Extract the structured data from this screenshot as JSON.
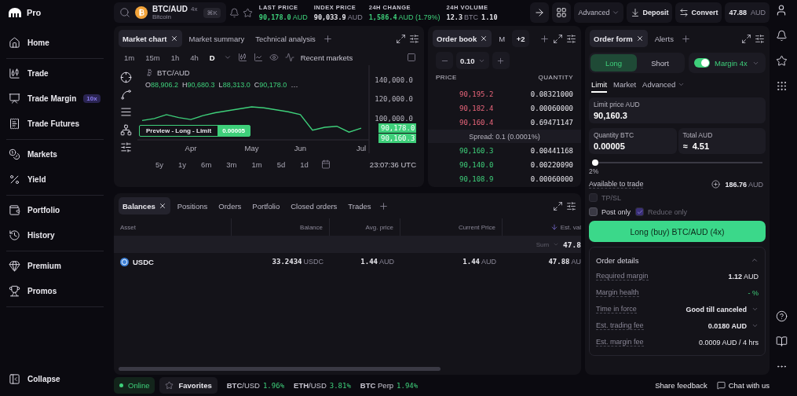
{
  "sidebar": {
    "logo": "Pro",
    "groups": [
      {
        "items": [
          {
            "label": "Home"
          }
        ]
      },
      {
        "items": [
          {
            "label": "Trade"
          },
          {
            "label": "Trade Margin",
            "badge": "10x"
          },
          {
            "label": "Trade Futures"
          }
        ]
      },
      {
        "items": [
          {
            "label": "Markets"
          },
          {
            "label": "Yield"
          }
        ]
      },
      {
        "items": [
          {
            "label": "Portfolio"
          },
          {
            "label": "History"
          }
        ]
      },
      {
        "items": [
          {
            "label": "Premium"
          },
          {
            "label": "Promos"
          }
        ]
      }
    ],
    "collapse": "Collapse"
  },
  "header": {
    "pair": "BTC/AUD",
    "leverage": "4x",
    "name": "Bitcoin",
    "shortcut": "⌘K",
    "stats": [
      {
        "label": "LAST PRICE",
        "value": "90,178.0",
        "unit": "AUD",
        "positive": true
      },
      {
        "label": "INDEX PRICE",
        "value": "90,033.9",
        "unit": "AUD",
        "positive": false
      },
      {
        "label": "24H CHANGE",
        "value": "1,586.4",
        "unit": "AUD (1.79%)",
        "positive": true
      },
      {
        "label": "24H VOLUME",
        "value": "12.3",
        "unit": "BTC",
        "extra": "1.10",
        "positive": false
      }
    ],
    "view_menu": "Advanced",
    "deposit": "Deposit",
    "convert": "Convert",
    "balance": "47.88",
    "balance_unit": "AUD"
  },
  "chart_panel": {
    "tabs": [
      {
        "label": "Market chart",
        "selected": true
      },
      {
        "label": "Market summary",
        "selected": false
      },
      {
        "label": "Technical analysis",
        "selected": false
      }
    ],
    "timeframes": [
      {
        "label": "1m",
        "selected": false
      },
      {
        "label": "15m",
        "selected": false
      },
      {
        "label": "1h",
        "selected": false
      },
      {
        "label": "4h",
        "selected": false
      },
      {
        "label": "D",
        "selected": true
      }
    ],
    "recent": "Recent markets",
    "legend": {
      "ohlc": [
        {
          "key": "O",
          "value": "88,906.2"
        },
        {
          "key": "H",
          "value": "90,680.3"
        },
        {
          "key": "L",
          "value": "88,313.0"
        },
        {
          "key": "C",
          "value": "90,178.0"
        }
      ],
      "more": "…"
    },
    "preview": {
      "label": "Preview - Long - Limit",
      "quantity": "0.00005"
    },
    "price_tags": [
      "90,178.0",
      "90,160.3"
    ],
    "chart_data": {
      "type": "line",
      "categories": [
        null,
        null,
        null,
        null,
        "Apr",
        null,
        null,
        null,
        null,
        "May",
        null,
        null,
        null,
        "Jun",
        null,
        null,
        null,
        null,
        "Jul"
      ],
      "series": [
        {
          "name": "BTC/AUD",
          "color": "#3ecf7a",
          "values": [
            98000,
            100000,
            104000,
            101000,
            99000,
            103000,
            106000,
            108000,
            110000,
            112000,
            111000,
            109000,
            107000,
            104000,
            88000,
            91000,
            92000,
            86000,
            90000
          ]
        }
      ],
      "ylim": [
        78000,
        155000
      ],
      "yticks": [
        {
          "value": 100000,
          "label": "100,000.0"
        },
        {
          "value": 120000,
          "label": "120,000.0"
        },
        {
          "value": 140000,
          "label": "140,000.0"
        }
      ]
    },
    "ranges": [
      "5y",
      "1y",
      "6m",
      "3m",
      "1m",
      "5d",
      "1d"
    ],
    "clock": "23:07:36 UTC"
  },
  "order_book": {
    "tabs": [
      {
        "label": "Order book",
        "selected": true
      },
      {
        "label": "M",
        "selected": false
      }
    ],
    "more_tabs": "+2",
    "tick_size": "0.10",
    "columns": [
      "PRICE",
      "QUANTITY"
    ],
    "asks": [
      {
        "price": "90,195.2",
        "quantity": "0.08321000"
      },
      {
        "price": "90,182.4",
        "quantity": "0.00060000"
      },
      {
        "price": "90,160.4",
        "quantity": "0.69471147"
      }
    ],
    "spread": "Spread: 0.1 (0.0001%)",
    "bids": [
      {
        "price": "90,160.3",
        "quantity": "0.00441168"
      },
      {
        "price": "90,140.0",
        "quantity": "0.00220090"
      },
      {
        "price": "90,108.9",
        "quantity": "0.00060000"
      }
    ]
  },
  "order_form": {
    "tabs": [
      {
        "label": "Order form",
        "selected": true
      },
      {
        "label": "Alerts",
        "selected": false
      }
    ],
    "sides": [
      {
        "label": "Long",
        "selected": true
      },
      {
        "label": "Short",
        "selected": false
      }
    ],
    "margin": {
      "label": "Margin 4x",
      "on": true
    },
    "order_types": [
      {
        "label": "Limit",
        "selected": true,
        "dropdown": false
      },
      {
        "label": "Market",
        "selected": false,
        "dropdown": false
      },
      {
        "label": "Advanced",
        "selected": false,
        "dropdown": true
      }
    ],
    "fields": [
      {
        "label": "Limit price AUD",
        "value": "90,160.3"
      },
      {
        "label": "Quantity BTC",
        "value": "0.00005"
      },
      {
        "label": "Total AUD",
        "value": "≈  4.51"
      }
    ],
    "slider": {
      "level": 0.02,
      "reading": "2%"
    },
    "available": {
      "label": "Available to trade",
      "value": "186.76",
      "unit": "AUD"
    },
    "options": [
      {
        "label": "TP/SL",
        "checked": false,
        "disabled": true
      },
      {
        "label": "Post only",
        "checked": false,
        "disabled": false
      },
      {
        "label": "Reduce only",
        "checked": true,
        "disabled": true
      }
    ],
    "submit": "Long (buy) BTC/AUD (4x)",
    "details": {
      "title": "Order details",
      "expanded": true,
      "rows": [
        {
          "label": "Required margin",
          "value": "**1.12** AUD",
          "kind": "plain"
        },
        {
          "label": "Margin health",
          "value": "- %",
          "kind": "positive"
        },
        {
          "label": "Time in force",
          "value": "Good till canceled",
          "kind": "select"
        },
        {
          "label": "Est. trading fee",
          "value": "0.0180 AUD",
          "kind": "select"
        },
        {
          "label": "Est. margin fee",
          "value": "0.0009 AUD / 4 hrs",
          "kind": "plain"
        }
      ]
    }
  },
  "balances_panel": {
    "tabs": [
      {
        "label": "Balances",
        "selected": true
      },
      {
        "label": "Positions",
        "selected": false
      },
      {
        "label": "Orders",
        "selected": false
      },
      {
        "label": "Portfolio",
        "selected": false
      },
      {
        "label": "Closed orders",
        "selected": false
      },
      {
        "label": "Trades",
        "selected": false
      }
    ],
    "columns": [
      {
        "label": "Asset",
        "sorted": false
      },
      {
        "label": "Balance",
        "sorted": false
      },
      {
        "label": "Avg. price",
        "sorted": false
      },
      {
        "label": "Current Price",
        "sorted": false
      },
      {
        "label": "Est. val",
        "sorted": true
      }
    ],
    "summary": {
      "label": "Sum",
      "value": "47.8"
    },
    "rows": [
      {
        "cells": [
          {
            "value": "USDC"
          },
          {
            "value": "33.2434",
            "unit": "USDC"
          },
          {
            "value": "1.44",
            "unit": "AUD"
          },
          {
            "value": "1.44",
            "unit": "AUD"
          },
          {
            "value": "47.88",
            "unit": "AU"
          }
        ]
      }
    ]
  },
  "status_bar": {
    "connection": "Online",
    "favorites": "Favorites",
    "tickers": [
      {
        "pair": "**BTC**/USD",
        "change": "1.96%"
      },
      {
        "pair": "**ETH**/USD",
        "change": "3.81%"
      },
      {
        "pair": "**BTC** Perp",
        "change": "1.94%"
      }
    ],
    "feedback": "Share feedback",
    "chat": "Chat with us"
  }
}
